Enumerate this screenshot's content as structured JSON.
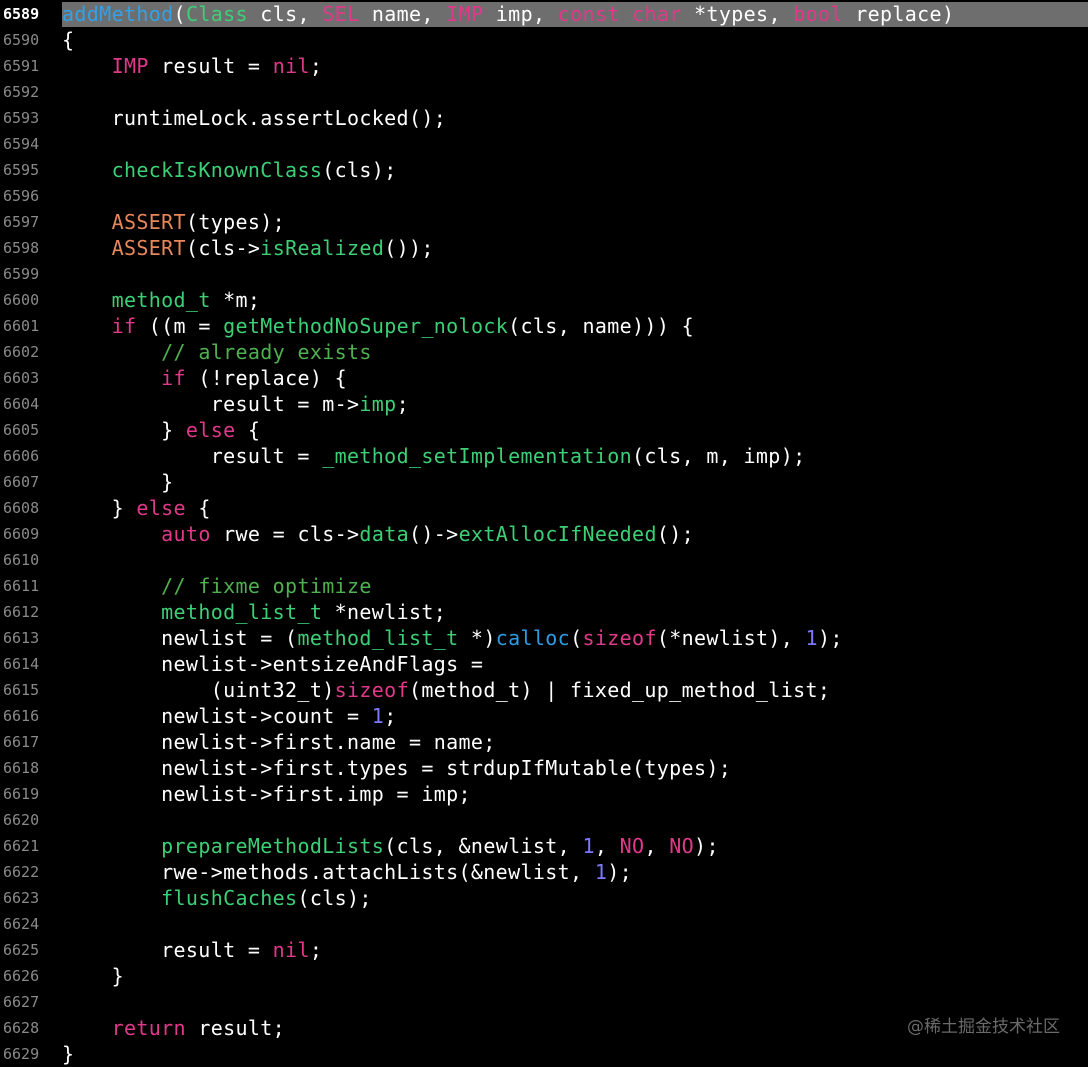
{
  "editor": {
    "current_line_number": "6589",
    "lines": [
      {
        "num": "6589",
        "tokens": [
          [
            "method-hdr",
            "addMethod"
          ],
          [
            "plain",
            "("
          ],
          [
            "type",
            "Class"
          ],
          [
            "plain",
            " cls, "
          ],
          [
            "kw",
            "SEL"
          ],
          [
            "plain",
            " name, "
          ],
          [
            "kw",
            "IMP"
          ],
          [
            "plain",
            " imp, "
          ],
          [
            "kw",
            "const"
          ],
          [
            "plain",
            " "
          ],
          [
            "kw",
            "char"
          ],
          [
            "plain",
            " *types, "
          ],
          [
            "kw",
            "bool"
          ],
          [
            "plain",
            " replace)"
          ]
        ]
      },
      {
        "num": "6590",
        "tokens": [
          [
            "plain",
            "{"
          ]
        ]
      },
      {
        "num": "6591",
        "tokens": [
          [
            "plain",
            "    "
          ],
          [
            "kw",
            "IMP"
          ],
          [
            "plain",
            " result = "
          ],
          [
            "kw",
            "nil"
          ],
          [
            "plain",
            ";"
          ]
        ]
      },
      {
        "num": "6592",
        "tokens": []
      },
      {
        "num": "6593",
        "tokens": [
          [
            "plain",
            "    runtimeLock.assertLocked();"
          ]
        ]
      },
      {
        "num": "6594",
        "tokens": []
      },
      {
        "num": "6595",
        "tokens": [
          [
            "plain",
            "    "
          ],
          [
            "fn",
            "checkIsKnownClass"
          ],
          [
            "plain",
            "(cls);"
          ]
        ]
      },
      {
        "num": "6596",
        "tokens": []
      },
      {
        "num": "6597",
        "tokens": [
          [
            "plain",
            "    "
          ],
          [
            "macro",
            "ASSERT"
          ],
          [
            "plain",
            "(types);"
          ]
        ]
      },
      {
        "num": "6598",
        "tokens": [
          [
            "plain",
            "    "
          ],
          [
            "macro",
            "ASSERT"
          ],
          [
            "plain",
            "(cls->"
          ],
          [
            "fn",
            "isRealized"
          ],
          [
            "plain",
            "());"
          ]
        ]
      },
      {
        "num": "6599",
        "tokens": []
      },
      {
        "num": "6600",
        "tokens": [
          [
            "plain",
            "    "
          ],
          [
            "type",
            "method_t"
          ],
          [
            "plain",
            " *m;"
          ]
        ]
      },
      {
        "num": "6601",
        "tokens": [
          [
            "plain",
            "    "
          ],
          [
            "kw",
            "if"
          ],
          [
            "plain",
            " ((m = "
          ],
          [
            "fn",
            "getMethodNoSuper_nolock"
          ],
          [
            "plain",
            "(cls, name))) {"
          ]
        ]
      },
      {
        "num": "6602",
        "tokens": [
          [
            "plain",
            "        "
          ],
          [
            "comment",
            "// already exists"
          ]
        ]
      },
      {
        "num": "6603",
        "tokens": [
          [
            "plain",
            "        "
          ],
          [
            "kw",
            "if"
          ],
          [
            "plain",
            " (!replace) {"
          ]
        ]
      },
      {
        "num": "6604",
        "tokens": [
          [
            "plain",
            "            result = m->"
          ],
          [
            "fn",
            "imp"
          ],
          [
            "plain",
            ";"
          ]
        ]
      },
      {
        "num": "6605",
        "tokens": [
          [
            "plain",
            "        } "
          ],
          [
            "kw",
            "else"
          ],
          [
            "plain",
            " {"
          ]
        ]
      },
      {
        "num": "6606",
        "tokens": [
          [
            "plain",
            "            result = "
          ],
          [
            "fn",
            "_method_setImplementation"
          ],
          [
            "plain",
            "(cls, m, imp);"
          ]
        ]
      },
      {
        "num": "6607",
        "tokens": [
          [
            "plain",
            "        }"
          ]
        ]
      },
      {
        "num": "6608",
        "tokens": [
          [
            "plain",
            "    } "
          ],
          [
            "kw",
            "else"
          ],
          [
            "plain",
            " {"
          ]
        ]
      },
      {
        "num": "6609",
        "tokens": [
          [
            "plain",
            "        "
          ],
          [
            "kw",
            "auto"
          ],
          [
            "plain",
            " rwe = cls->"
          ],
          [
            "fn",
            "data"
          ],
          [
            "plain",
            "()->"
          ],
          [
            "fn",
            "extAllocIfNeeded"
          ],
          [
            "plain",
            "();"
          ]
        ]
      },
      {
        "num": "6610",
        "tokens": []
      },
      {
        "num": "6611",
        "tokens": [
          [
            "plain",
            "        "
          ],
          [
            "comment",
            "// fixme optimize"
          ]
        ]
      },
      {
        "num": "6612",
        "tokens": [
          [
            "plain",
            "        "
          ],
          [
            "type",
            "method_list_t"
          ],
          [
            "plain",
            " *newlist;"
          ]
        ]
      },
      {
        "num": "6613",
        "tokens": [
          [
            "plain",
            "        newlist = ("
          ],
          [
            "type",
            "method_list_t"
          ],
          [
            "plain",
            " *)"
          ],
          [
            "lib",
            "calloc"
          ],
          [
            "plain",
            "("
          ],
          [
            "kw",
            "sizeof"
          ],
          [
            "plain",
            "(*newlist), "
          ],
          [
            "num",
            "1"
          ],
          [
            "plain",
            ");"
          ]
        ]
      },
      {
        "num": "6614",
        "tokens": [
          [
            "plain",
            "        newlist->entsizeAndFlags ="
          ]
        ]
      },
      {
        "num": "6615",
        "tokens": [
          [
            "plain",
            "            (uint32_t)"
          ],
          [
            "kw",
            "sizeof"
          ],
          [
            "plain",
            "(method_t) | fixed_up_method_list;"
          ]
        ]
      },
      {
        "num": "6616",
        "tokens": [
          [
            "plain",
            "        newlist->count = "
          ],
          [
            "num",
            "1"
          ],
          [
            "plain",
            ";"
          ]
        ]
      },
      {
        "num": "6617",
        "tokens": [
          [
            "plain",
            "        newlist->first.name = name;"
          ]
        ]
      },
      {
        "num": "6618",
        "tokens": [
          [
            "plain",
            "        newlist->first.types = strdupIfMutable(types);"
          ]
        ]
      },
      {
        "num": "6619",
        "tokens": [
          [
            "plain",
            "        newlist->first.imp = imp;"
          ]
        ]
      },
      {
        "num": "6620",
        "tokens": []
      },
      {
        "num": "6621",
        "tokens": [
          [
            "plain",
            "        "
          ],
          [
            "fn",
            "prepareMethodLists"
          ],
          [
            "plain",
            "(cls, &newlist, "
          ],
          [
            "num",
            "1"
          ],
          [
            "plain",
            ", "
          ],
          [
            "kw",
            "NO"
          ],
          [
            "plain",
            ", "
          ],
          [
            "kw",
            "NO"
          ],
          [
            "plain",
            ");"
          ]
        ]
      },
      {
        "num": "6622",
        "tokens": [
          [
            "plain",
            "        rwe->methods.attachLists(&newlist, "
          ],
          [
            "num",
            "1"
          ],
          [
            "plain",
            ");"
          ]
        ]
      },
      {
        "num": "6623",
        "tokens": [
          [
            "plain",
            "        "
          ],
          [
            "fn",
            "flushCaches"
          ],
          [
            "plain",
            "(cls);"
          ]
        ]
      },
      {
        "num": "6624",
        "tokens": []
      },
      {
        "num": "6625",
        "tokens": [
          [
            "plain",
            "        result = "
          ],
          [
            "kw",
            "nil"
          ],
          [
            "plain",
            ";"
          ]
        ]
      },
      {
        "num": "6626",
        "tokens": [
          [
            "plain",
            "    }"
          ]
        ]
      },
      {
        "num": "6627",
        "tokens": []
      },
      {
        "num": "6628",
        "tokens": [
          [
            "plain",
            "    "
          ],
          [
            "kw",
            "return"
          ],
          [
            "plain",
            " result;"
          ]
        ]
      },
      {
        "num": "6629",
        "tokens": [
          [
            "plain",
            "}"
          ]
        ]
      }
    ]
  },
  "watermark": "@稀土掘金技术社区",
  "colors": {
    "background": "#000000",
    "highlight_bar": "#6e6e6e",
    "keyword": "#e0398a",
    "function": "#3ccf76",
    "macro": "#e8875a",
    "comment": "#4fb04f",
    "number": "#7c78ff",
    "library_call": "#2f9be0",
    "method_header": "#33a1e6"
  }
}
